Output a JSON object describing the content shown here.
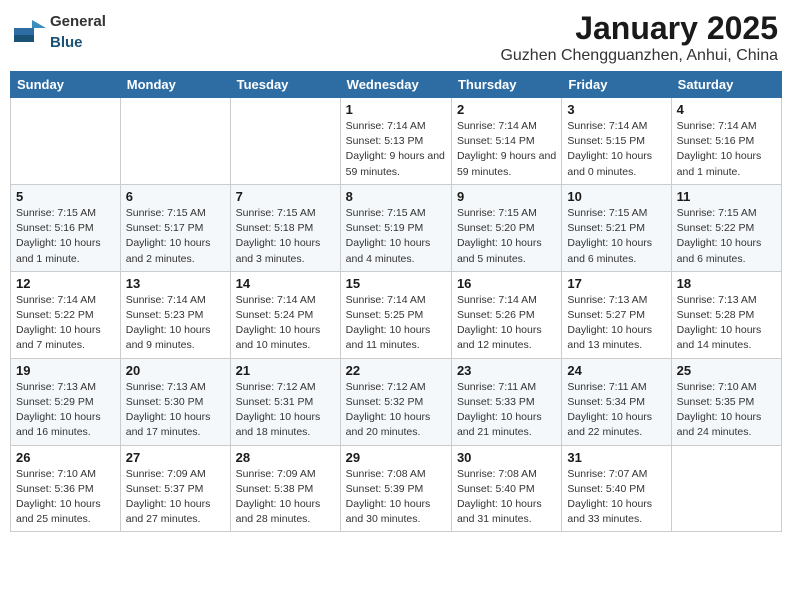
{
  "header": {
    "logo_general": "General",
    "logo_blue": "Blue",
    "title": "January 2025",
    "subtitle": "Guzhen Chengguanzhen, Anhui, China"
  },
  "weekdays": [
    "Sunday",
    "Monday",
    "Tuesday",
    "Wednesday",
    "Thursday",
    "Friday",
    "Saturday"
  ],
  "weeks": [
    [
      {
        "day": "",
        "info": ""
      },
      {
        "day": "",
        "info": ""
      },
      {
        "day": "",
        "info": ""
      },
      {
        "day": "1",
        "info": "Sunrise: 7:14 AM\nSunset: 5:13 PM\nDaylight: 9 hours and 59 minutes."
      },
      {
        "day": "2",
        "info": "Sunrise: 7:14 AM\nSunset: 5:14 PM\nDaylight: 9 hours and 59 minutes."
      },
      {
        "day": "3",
        "info": "Sunrise: 7:14 AM\nSunset: 5:15 PM\nDaylight: 10 hours and 0 minutes."
      },
      {
        "day": "4",
        "info": "Sunrise: 7:14 AM\nSunset: 5:16 PM\nDaylight: 10 hours and 1 minute."
      }
    ],
    [
      {
        "day": "5",
        "info": "Sunrise: 7:15 AM\nSunset: 5:16 PM\nDaylight: 10 hours and 1 minute."
      },
      {
        "day": "6",
        "info": "Sunrise: 7:15 AM\nSunset: 5:17 PM\nDaylight: 10 hours and 2 minutes."
      },
      {
        "day": "7",
        "info": "Sunrise: 7:15 AM\nSunset: 5:18 PM\nDaylight: 10 hours and 3 minutes."
      },
      {
        "day": "8",
        "info": "Sunrise: 7:15 AM\nSunset: 5:19 PM\nDaylight: 10 hours and 4 minutes."
      },
      {
        "day": "9",
        "info": "Sunrise: 7:15 AM\nSunset: 5:20 PM\nDaylight: 10 hours and 5 minutes."
      },
      {
        "day": "10",
        "info": "Sunrise: 7:15 AM\nSunset: 5:21 PM\nDaylight: 10 hours and 6 minutes."
      },
      {
        "day": "11",
        "info": "Sunrise: 7:15 AM\nSunset: 5:22 PM\nDaylight: 10 hours and 6 minutes."
      }
    ],
    [
      {
        "day": "12",
        "info": "Sunrise: 7:14 AM\nSunset: 5:22 PM\nDaylight: 10 hours and 7 minutes."
      },
      {
        "day": "13",
        "info": "Sunrise: 7:14 AM\nSunset: 5:23 PM\nDaylight: 10 hours and 9 minutes."
      },
      {
        "day": "14",
        "info": "Sunrise: 7:14 AM\nSunset: 5:24 PM\nDaylight: 10 hours and 10 minutes."
      },
      {
        "day": "15",
        "info": "Sunrise: 7:14 AM\nSunset: 5:25 PM\nDaylight: 10 hours and 11 minutes."
      },
      {
        "day": "16",
        "info": "Sunrise: 7:14 AM\nSunset: 5:26 PM\nDaylight: 10 hours and 12 minutes."
      },
      {
        "day": "17",
        "info": "Sunrise: 7:13 AM\nSunset: 5:27 PM\nDaylight: 10 hours and 13 minutes."
      },
      {
        "day": "18",
        "info": "Sunrise: 7:13 AM\nSunset: 5:28 PM\nDaylight: 10 hours and 14 minutes."
      }
    ],
    [
      {
        "day": "19",
        "info": "Sunrise: 7:13 AM\nSunset: 5:29 PM\nDaylight: 10 hours and 16 minutes."
      },
      {
        "day": "20",
        "info": "Sunrise: 7:13 AM\nSunset: 5:30 PM\nDaylight: 10 hours and 17 minutes."
      },
      {
        "day": "21",
        "info": "Sunrise: 7:12 AM\nSunset: 5:31 PM\nDaylight: 10 hours and 18 minutes."
      },
      {
        "day": "22",
        "info": "Sunrise: 7:12 AM\nSunset: 5:32 PM\nDaylight: 10 hours and 20 minutes."
      },
      {
        "day": "23",
        "info": "Sunrise: 7:11 AM\nSunset: 5:33 PM\nDaylight: 10 hours and 21 minutes."
      },
      {
        "day": "24",
        "info": "Sunrise: 7:11 AM\nSunset: 5:34 PM\nDaylight: 10 hours and 22 minutes."
      },
      {
        "day": "25",
        "info": "Sunrise: 7:10 AM\nSunset: 5:35 PM\nDaylight: 10 hours and 24 minutes."
      }
    ],
    [
      {
        "day": "26",
        "info": "Sunrise: 7:10 AM\nSunset: 5:36 PM\nDaylight: 10 hours and 25 minutes."
      },
      {
        "day": "27",
        "info": "Sunrise: 7:09 AM\nSunset: 5:37 PM\nDaylight: 10 hours and 27 minutes."
      },
      {
        "day": "28",
        "info": "Sunrise: 7:09 AM\nSunset: 5:38 PM\nDaylight: 10 hours and 28 minutes."
      },
      {
        "day": "29",
        "info": "Sunrise: 7:08 AM\nSunset: 5:39 PM\nDaylight: 10 hours and 30 minutes."
      },
      {
        "day": "30",
        "info": "Sunrise: 7:08 AM\nSunset: 5:40 PM\nDaylight: 10 hours and 31 minutes."
      },
      {
        "day": "31",
        "info": "Sunrise: 7:07 AM\nSunset: 5:40 PM\nDaylight: 10 hours and 33 minutes."
      },
      {
        "day": "",
        "info": ""
      }
    ]
  ]
}
